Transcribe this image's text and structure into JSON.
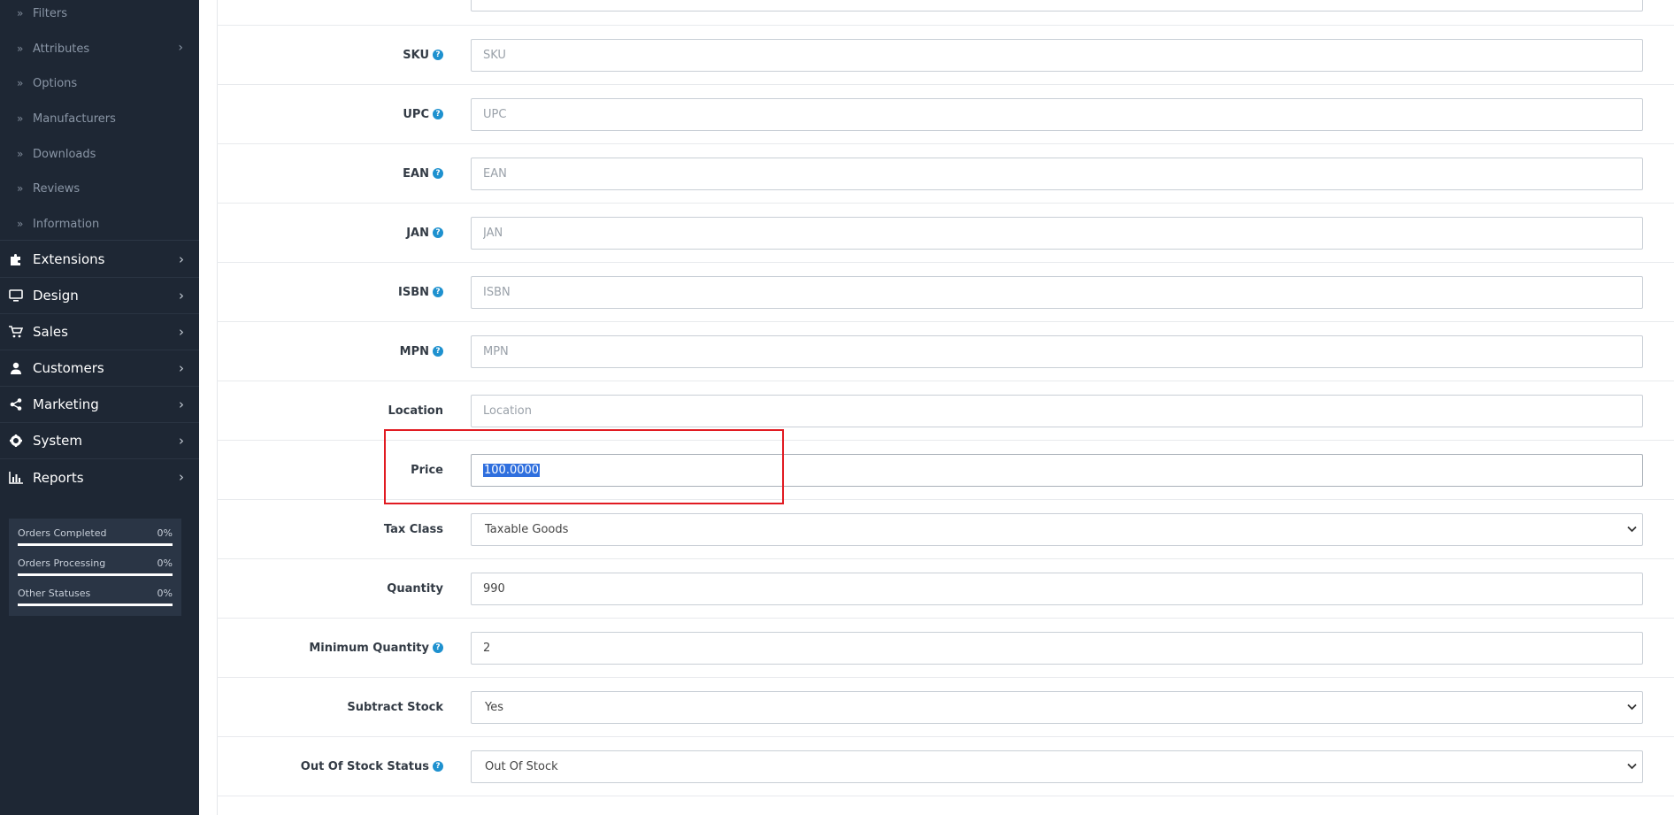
{
  "sidebar": {
    "sub_items": [
      {
        "label": "Filters",
        "has_chevron": false
      },
      {
        "label": "Attributes",
        "has_chevron": true
      },
      {
        "label": "Options",
        "has_chevron": false
      },
      {
        "label": "Manufacturers",
        "has_chevron": false
      },
      {
        "label": "Downloads",
        "has_chevron": false
      },
      {
        "label": "Reviews",
        "has_chevron": false
      },
      {
        "label": "Information",
        "has_chevron": false
      }
    ],
    "main_items": [
      {
        "label": "Extensions",
        "icon": "puzzle-icon"
      },
      {
        "label": "Design",
        "icon": "monitor-icon"
      },
      {
        "label": "Sales",
        "icon": "cart-icon"
      },
      {
        "label": "Customers",
        "icon": "user-icon"
      },
      {
        "label": "Marketing",
        "icon": "share-icon"
      },
      {
        "label": "System",
        "icon": "gear-icon"
      },
      {
        "label": "Reports",
        "icon": "bar-chart-icon"
      }
    ],
    "stats": [
      {
        "label": "Orders Completed",
        "percent": "0%"
      },
      {
        "label": "Orders Processing",
        "percent": "0%"
      },
      {
        "label": "Other Statuses",
        "percent": "0%"
      }
    ]
  },
  "form": {
    "sku": {
      "label": "SKU",
      "placeholder": "SKU",
      "value": ""
    },
    "upc": {
      "label": "UPC",
      "placeholder": "UPC",
      "value": ""
    },
    "ean": {
      "label": "EAN",
      "placeholder": "EAN",
      "value": ""
    },
    "jan": {
      "label": "JAN",
      "placeholder": "JAN",
      "value": ""
    },
    "isbn": {
      "label": "ISBN",
      "placeholder": "ISBN",
      "value": ""
    },
    "mpn": {
      "label": "MPN",
      "placeholder": "MPN",
      "value": ""
    },
    "location": {
      "label": "Location",
      "placeholder": "Location",
      "value": ""
    },
    "price": {
      "label": "Price",
      "value": "100.0000"
    },
    "tax_class": {
      "label": "Tax Class",
      "value": "Taxable Goods"
    },
    "quantity": {
      "label": "Quantity",
      "value": "990"
    },
    "minimum_quantity": {
      "label": "Minimum Quantity",
      "value": "2"
    },
    "subtract_stock": {
      "label": "Subtract Stock",
      "value": "Yes"
    },
    "out_of_stock_status": {
      "label": "Out Of Stock Status",
      "value": "Out Of Stock"
    }
  },
  "icons": {
    "help": "?",
    "chevron": "›",
    "double_chevron": "»",
    "caret": "⌄"
  },
  "colors": {
    "sidebar_bg": "#1e2734",
    "help_blue": "#1e91cf",
    "highlight_red": "#e11b22",
    "selection_blue": "#2f6fde"
  }
}
